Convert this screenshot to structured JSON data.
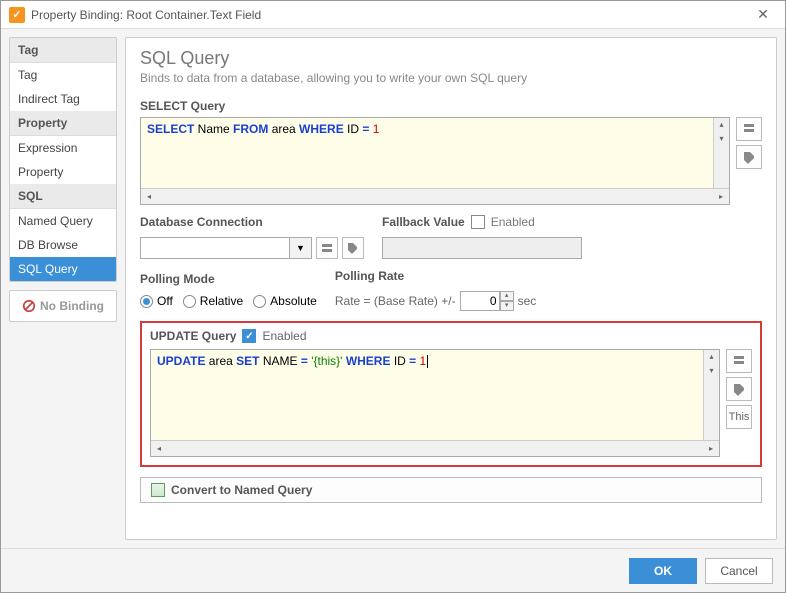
{
  "window": {
    "title": "Property Binding: Root Container.Text Field",
    "icon_glyph": "✓"
  },
  "sidebar": {
    "groups": [
      {
        "label": "Tag",
        "items": [
          "Tag",
          "Indirect Tag"
        ]
      },
      {
        "label": "Property",
        "items": [
          "Expression",
          "Property"
        ]
      },
      {
        "label": "SQL",
        "items": [
          "Named Query",
          "DB Browse",
          "SQL Query"
        ],
        "selected": "SQL Query"
      }
    ],
    "no_binding": "No Binding"
  },
  "page": {
    "title": "SQL Query",
    "subtitle": "Binds to data from a database, allowing you to write your own SQL query"
  },
  "select_query": {
    "label": "SELECT Query",
    "tokens": [
      "SELECT",
      " Name ",
      "FROM",
      " area ",
      "WHERE",
      " ID ",
      "=",
      " ",
      "1"
    ]
  },
  "db": {
    "label": "Database Connection",
    "value": ""
  },
  "fallback": {
    "label": "Fallback Value",
    "enabled_label": "Enabled",
    "enabled": false,
    "value": ""
  },
  "polling": {
    "mode_label": "Polling Mode",
    "rate_label": "Polling Rate",
    "options": [
      "Off",
      "Relative",
      "Absolute"
    ],
    "selected": "Off",
    "rate_prefix": "Rate = (Base Rate) +/-",
    "rate_value": "0",
    "rate_suffix": "sec"
  },
  "update_query": {
    "label": "UPDATE Query",
    "enabled_label": "Enabled",
    "enabled": true,
    "tokens": [
      "UPDATE",
      " area ",
      "SET",
      " NAME ",
      "=",
      " ",
      "'{this}'",
      " ",
      "WHERE",
      " ID ",
      "=",
      " ",
      "1"
    ],
    "this_btn": "This"
  },
  "convert_btn": "Convert to Named Query",
  "footer": {
    "ok": "OK",
    "cancel": "Cancel"
  }
}
